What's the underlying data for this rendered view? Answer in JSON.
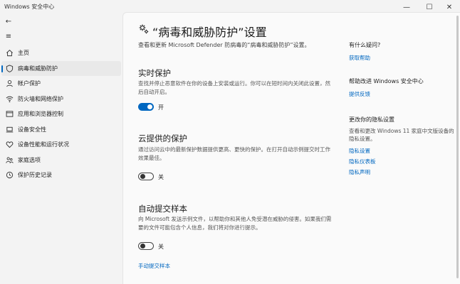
{
  "window": {
    "title": "Windows 安全中心",
    "minimize_glyph": "—",
    "maximize_glyph": "☐",
    "close_glyph": "✕"
  },
  "sidebar": {
    "back_glyph": "←",
    "menu_glyph": "≡",
    "items": [
      {
        "label": "主页",
        "icon": "home-icon"
      },
      {
        "label": "病毒和威胁防护",
        "icon": "shield-icon",
        "active": true
      },
      {
        "label": "帐户保护",
        "icon": "person-icon"
      },
      {
        "label": "防火墙和网络保护",
        "icon": "wifi-icon"
      },
      {
        "label": "应用和浏览器控制",
        "icon": "app-window-icon"
      },
      {
        "label": "设备安全性",
        "icon": "laptop-icon"
      },
      {
        "label": "设备性能和运行状况",
        "icon": "heart-icon"
      },
      {
        "label": "家庭选项",
        "icon": "family-icon"
      },
      {
        "label": "保护历史记录",
        "icon": "history-icon"
      }
    ]
  },
  "main": {
    "title": "“病毒和威胁防护”设置",
    "description": "查看和更新 Microsoft Defender 防病毒的“病毒和威胁防护”设置。",
    "sections": [
      {
        "title": "实时保护",
        "description": "查找并停止恶意软件在你的设备上安装或运行。你可以在短时间内关闭此设置，然后自动开启。",
        "toggle_on": true,
        "toggle_label": "开"
      },
      {
        "title": "云提供的保护",
        "description": "通过访问云中的最新保护数据提供更高、更快的保护。在打开自动示例提交时工作效果最佳。",
        "toggle_on": false,
        "toggle_label": "关"
      },
      {
        "title": "自动提交样本",
        "description": "向 Microsoft 发送示例文件，以帮助你和其他人免受潜在威胁的侵害。如果我们需要的文件可能包含个人信息，我们将对你进行提示。",
        "toggle_on": false,
        "toggle_label": "关"
      }
    ],
    "manual_submit_link": "手动提交样本"
  },
  "right_panel": {
    "help": {
      "heading": "有什么疑问?",
      "link": "获取帮助"
    },
    "improve": {
      "heading": "帮助改进 Windows 安全中心",
      "link": "提供反馈"
    },
    "privacy": {
      "heading": "更改你的隐私设置",
      "text": "查看和更改 Windows 11 家庭中文版设备的隐私设置。",
      "links": [
        "隐私设置",
        "隐私仪表板",
        "隐私声明"
      ]
    }
  },
  "colors": {
    "accent": "#0067c0"
  }
}
